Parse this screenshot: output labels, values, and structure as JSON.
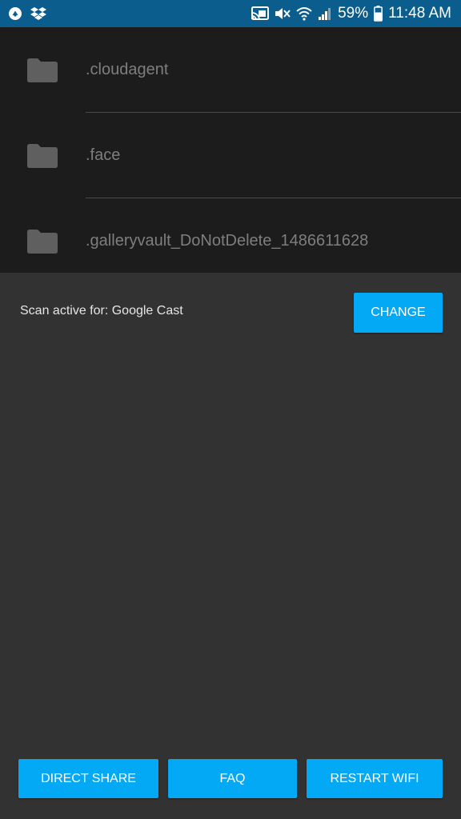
{
  "status_bar": {
    "battery_percent": "59%",
    "time": "11:48 AM",
    "left_icons": [
      "app-notification-icon",
      "dropbox-icon"
    ],
    "right_icons": [
      "cast-icon",
      "mute-icon",
      "wifi-icon",
      "signal-icon",
      "battery-icon"
    ]
  },
  "folders": [
    {
      "name": ".cloudagent"
    },
    {
      "name": ".face"
    },
    {
      "name": ".galleryvault_DoNotDelete_1486611628"
    }
  ],
  "scan": {
    "status_text": "Scan active for: Google Cast",
    "change_label": "CHANGE"
  },
  "bottom_actions": {
    "direct_share_label": "DIRECT SHARE",
    "faq_label": "FAQ",
    "restart_wifi_label": "RESTART WIFI"
  },
  "colors": {
    "status_bar": "#0a5d8c",
    "accent": "#03a9f4",
    "list_background": "#1c1c1c",
    "panel_background": "#323232"
  }
}
